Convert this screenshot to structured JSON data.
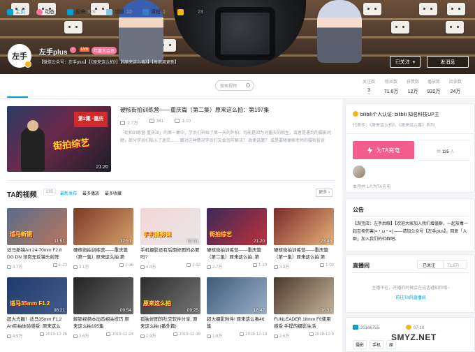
{
  "banner": {
    "username": "左手plus",
    "level": "LV6",
    "vip_badge": "年度大会员",
    "signature": "【微信公众号：左手plus】【《原来这么拍》】【《原来这么毒》】【每周周更新】",
    "avatar_text": "左手",
    "followed_label": "已关注",
    "message_label": "发消息"
  },
  "nav": {
    "items": [
      {
        "label": "主页",
        "count": ""
      },
      {
        "label": "动态",
        "count": ""
      },
      {
        "label": "投稿",
        "count": "326"
      },
      {
        "label": "频道",
        "count": "10"
      },
      {
        "label": "课程",
        "count": "1"
      },
      {
        "label": "收藏",
        "count": "23"
      }
    ],
    "search_placeholder": "搜索视频",
    "stats": [
      {
        "label": "关注数",
        "value": "3"
      },
      {
        "label": "粉丝数",
        "value": "71.6万"
      },
      {
        "label": "获赞数",
        "value": "12万"
      },
      {
        "label": "播放数",
        "value": "932万"
      },
      {
        "label": "阅读数",
        "value": "24万"
      }
    ]
  },
  "featured": {
    "title": "硬核街拍训练营——重庆篇（第二集）原来这么拍：第197集",
    "plays": "2.7万",
    "danmaku": "341",
    "date": "1-10",
    "duration": "21:20",
    "thumb_caption_1": "第2集 ·重庆",
    "thumb_caption_2": "街拍综艺",
    "description": "「街拍训练营·重庆站」的第一集中，学员们开始了第一天的外拍，可能是因为对重庆的陌生，或者是遇到的摄影问题，部分学员们陷入了迷茫…… 面对这种情况学员们又会怎样解决？ 改更选题？ 或是要随便家老师的摄街投诉"
  },
  "videos_section": {
    "title": "TA的视频",
    "count": "285",
    "sort_options": [
      "最新发布",
      "最多播放",
      "最多收藏"
    ],
    "more_label": "更多"
  },
  "videos": [
    {
      "title": "适马新镜Art 24-70mm F2.8 DG DN 领岗无反镜头射阵",
      "duration": "11:51",
      "plays": "3.7万",
      "date": "1-23",
      "caption": "适马新镜",
      "color1": "#5a6d8a",
      "color2": "#b9765e"
    },
    {
      "title": "硬核街拍训练营——重庆篇（第一集）原来这么拍 第",
      "duration": "32:51",
      "plays": "3.1万",
      "date": "1-16",
      "caption": "",
      "color1": "#7a3a28",
      "color2": "#d7a06b"
    },
    {
      "title": "手机摄影还有后期修图的必要吗?",
      "duration": "01:01",
      "plays": "4.8万",
      "date": "1-12",
      "caption": "手机摄影课",
      "color1": "#f3d6d6",
      "color2": "#e7e7e7"
    },
    {
      "title": "硬核街拍训练营——重庆篇（第二集）原来这么拍: 第",
      "duration": "21:20",
      "plays": "2.7万",
      "date": "1-10",
      "caption": "街拍综艺",
      "color1": "#3a2a5a",
      "color2": "#c0303a"
    },
    {
      "title": "硬核街拍训练营——重庆篇（第一集）原来这么拍 第",
      "duration": "23:45",
      "plays": "3.3万",
      "date": "1-03",
      "caption": "",
      "color1": "#7b2a2a",
      "color2": "#e6b27a"
    },
    {
      "title": "超大光圈！适马35mm F1.2 Art实拍体验感受: 原来这么",
      "duration": "08:21",
      "plays": "4.9万",
      "date": "2019-12-26",
      "caption": "适马35mm F1.2",
      "color1": "#1f3a6b",
      "color2": "#445c8c"
    },
    {
      "title": "解锁视频本动态相关技巧 原来这么拍195集",
      "duration": "09:54",
      "plays": "2.6万",
      "date": "2019-12-24",
      "caption": "",
      "color1": "#222",
      "color2": "#6b6b6b"
    },
    {
      "title": "孤独修图的社交软件分享: 原来这么拍 (番外篇)",
      "duration": "09:25",
      "plays": "2.9万",
      "date": "2019-12-19",
      "caption": "原来这么拍",
      "color1": "#2b2b2b",
      "color2": "#777"
    },
    {
      "title": "超大摄影附件! 原来这么毒46集",
      "duration": "18:47",
      "plays": "1.8万",
      "date": "2019-12-13",
      "caption": "",
      "color1": "#3d5a7a",
      "color2": "#9bb0c8"
    },
    {
      "title": "FUNLEADER 18mm F8使用感受 手提的摄影生活",
      "duration": "06:33",
      "plays": "2.6万",
      "date": "2019-12-9",
      "caption": "",
      "color1": "#4a3a2c",
      "color2": "#c8b59b"
    }
  ],
  "sidebar": {
    "cert_title": "bilibili个人认证: bilibili 知名科技UP主",
    "cert_sub": "代表作：《原来这么拍》、《原来这么毒》系列",
    "charge_label": "为TA充电",
    "charge_count_prefix": "共",
    "charge_count": "135",
    "charge_count_suffix": "人",
    "charge_note": "本月共 1人为TA充电",
    "notice_title": "公告",
    "notice_text": "【淘宝店：左手后眼】【欢迎大家加入我们增值群，一起放毒一起互相伤害(=・ω・=) ——请加公众号【左手plus】，回复「入群」加入我们的社群吧。",
    "live_title": "直播间",
    "live_followed": "已关注",
    "live_fans": "71.6万",
    "live_msg": "主播不在，开播的时候会在这边通知你哦~",
    "live_link": "前往TA的直播间",
    "uid": "20166755",
    "birthday": "07-10",
    "tags": [
      "摄影",
      "手机",
      "原"
    ]
  },
  "watermark": "SMYZ.NET"
}
